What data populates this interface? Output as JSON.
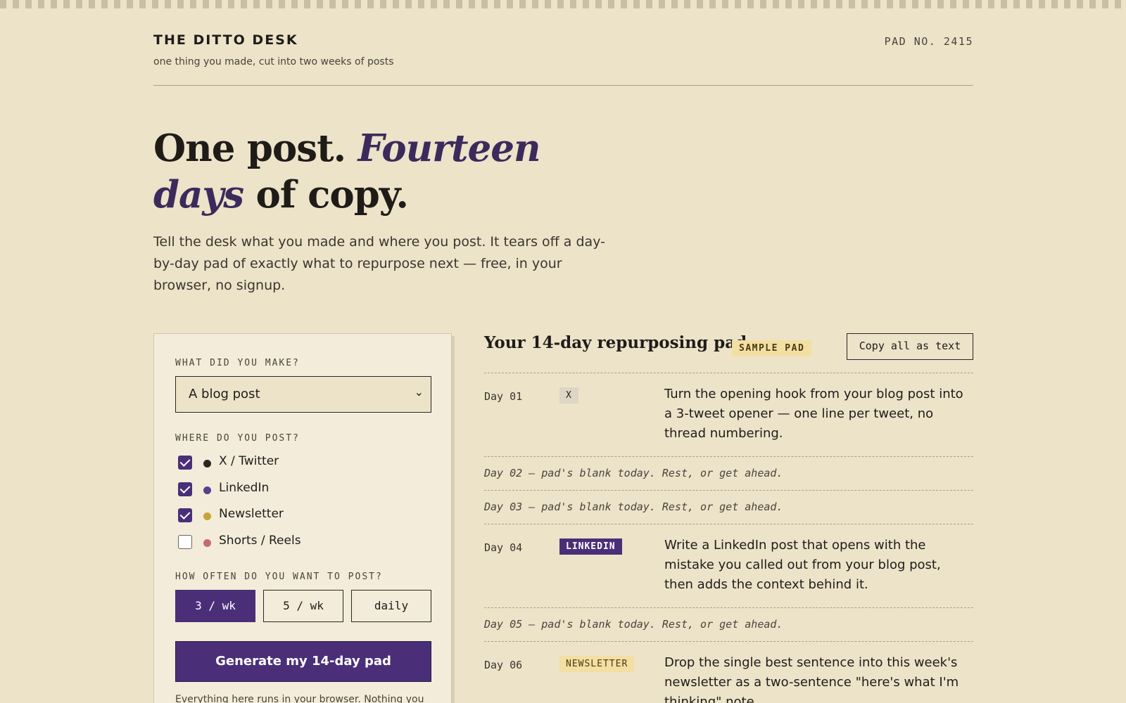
{
  "brand": {
    "name": "THE DITTO DESK",
    "tagline": "one thing you made, cut into two weeks of posts",
    "pad_number": "PAD NO. 2415"
  },
  "hero": {
    "line1_plain": "One post. ",
    "line1_accent": "Fourteen",
    "line2_accent": "days",
    "line2_plain": " of copy.",
    "lede": "Tell the desk what you made and where you post. It tears off a day-by-day pad of exactly what to repurpose next — free, in your browser, no signup."
  },
  "form": {
    "made_label": "WHAT DID YOU MAKE?",
    "made_value": "A blog post",
    "made_chevron": "⌄",
    "where_label": "WHERE DO YOU POST?",
    "platforms": [
      {
        "label": "X / Twitter",
        "checked": true,
        "dot_color": "#2a2622"
      },
      {
        "label": "LinkedIn",
        "checked": true,
        "dot_color": "#5a3f8c"
      },
      {
        "label": "Newsletter",
        "checked": true,
        "dot_color": "#c9a13b"
      },
      {
        "label": "Shorts / Reels",
        "checked": false,
        "dot_color": "#c46a7a"
      }
    ],
    "freq_label": "HOW OFTEN DO YOU WANT TO POST?",
    "freq_options": [
      "3 / wk",
      "5 / wk",
      "daily"
    ],
    "freq_selected": "3 / wk",
    "generate_label": "Generate my 14-day pad",
    "footnote": "Everything here runs in your browser. Nothing you"
  },
  "pad": {
    "title": "Your 14-day repurposing pad",
    "badge": "SAMPLE PAD",
    "copy_all": "Copy all as text",
    "days": [
      {
        "day": "Day 01",
        "chip": "X",
        "chip_style": "x",
        "task": "Turn the opening hook from your blog post into a 3-tweet opener — one line per tweet, no thread numbering."
      },
      {
        "blank": "Day 02 — pad's blank today. Rest, or get ahead."
      },
      {
        "blank": "Day 03 — pad's blank today. Rest, or get ahead."
      },
      {
        "day": "Day 04",
        "chip": "LINKEDIN",
        "chip_style": "linkedin",
        "task": "Write a LinkedIn post that opens with the mistake you called out from your blog post, then adds the context behind it."
      },
      {
        "blank": "Day 05 — pad's blank today. Rest, or get ahead."
      },
      {
        "day": "Day 06",
        "chip": "NEWSLETTER",
        "chip_style": "newsletter",
        "task": "Drop the single best sentence into this week's newsletter as a two-sentence \"here's what I'm thinking\" note."
      }
    ]
  },
  "colors": {
    "accent": "#4a2f78",
    "background": "#ece3c9",
    "chip_x_bg": "#ddd6c4",
    "chip_linkedin_bg": "#4a2f78",
    "chip_newsletter_bg": "#f3dfa2"
  }
}
